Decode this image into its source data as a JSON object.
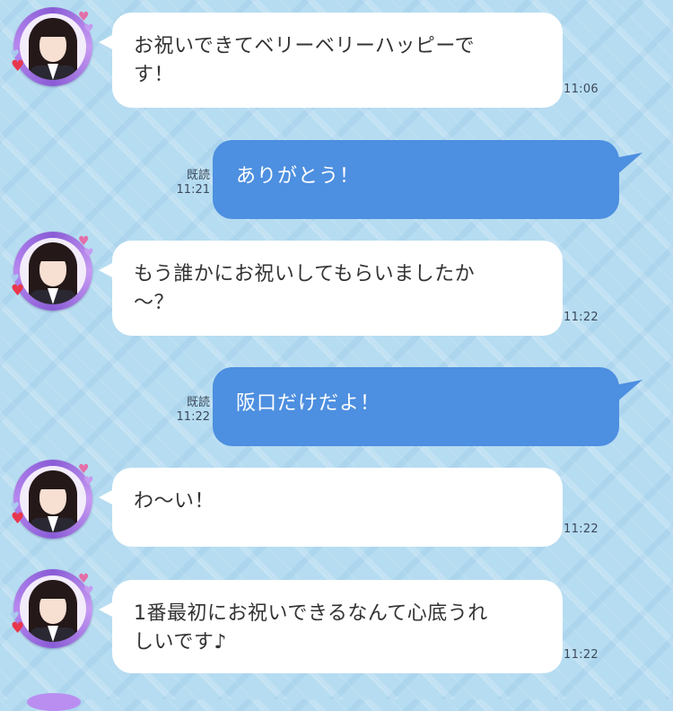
{
  "messages": [
    {
      "direction": "incoming",
      "lines": [
        "お祝いできてベリーベリーハッピーで",
        "す！"
      ],
      "time": "11:06"
    },
    {
      "direction": "outgoing",
      "text": "ありがとう！",
      "read_label": "既読",
      "time": "11:21"
    },
    {
      "direction": "incoming",
      "lines": [
        "もう誰かにお祝いしてもらいましたか",
        "〜？"
      ],
      "time": "11:22"
    },
    {
      "direction": "outgoing",
      "text": "阪口だけだよ！",
      "read_label": "既読",
      "time": "11:22"
    },
    {
      "direction": "incoming",
      "lines": [
        "わ〜い！"
      ],
      "time": "11:22"
    },
    {
      "direction": "incoming",
      "lines": [
        "1番最初にお祝いできるなんて心底うれ",
        "しいです♪"
      ],
      "time": "11:22"
    }
  ],
  "colors": {
    "background": "#b6dcf1",
    "incoming_bubble": "#ffffff",
    "outgoing_bubble": "#4d8fe0",
    "avatar_frame": "#8a5cd6"
  },
  "icons": {
    "avatar": "member-avatar-icon",
    "heart": "heart-icon"
  }
}
